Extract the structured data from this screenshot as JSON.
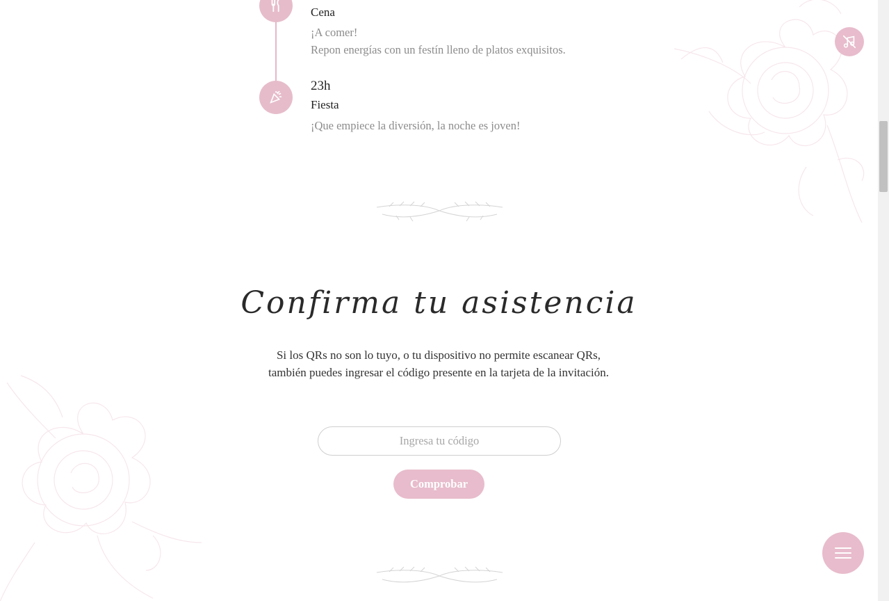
{
  "timeline": {
    "dinner": {
      "title": "Cena",
      "desc_line1": "¡A comer!",
      "desc_line2": "Repon energías con un festín lleno de platos exquisitos.",
      "icon": "fork-knife-icon"
    },
    "party": {
      "time": "23h",
      "title": "Fiesta",
      "desc": "¡Que empiece la diversión, la noche es joven!",
      "icon": "party-popper-icon"
    }
  },
  "rsvp": {
    "heading": "Confirma tu asistencia",
    "text": "Si los QRs no son lo tuyo, o tu dispositivo no permite escanear QRs, también puedes ingresar el código presente en la tarjeta de la invitación.",
    "input_placeholder": "Ingresa tu código",
    "button_label": "Comprobar"
  },
  "controls": {
    "music_icon": "music-off-icon",
    "menu_icon": "hamburger-menu-icon"
  },
  "colors": {
    "accent": "#e8bccc",
    "timeline_line": "#e6b6c8",
    "muted_text": "#8c8c8c"
  }
}
